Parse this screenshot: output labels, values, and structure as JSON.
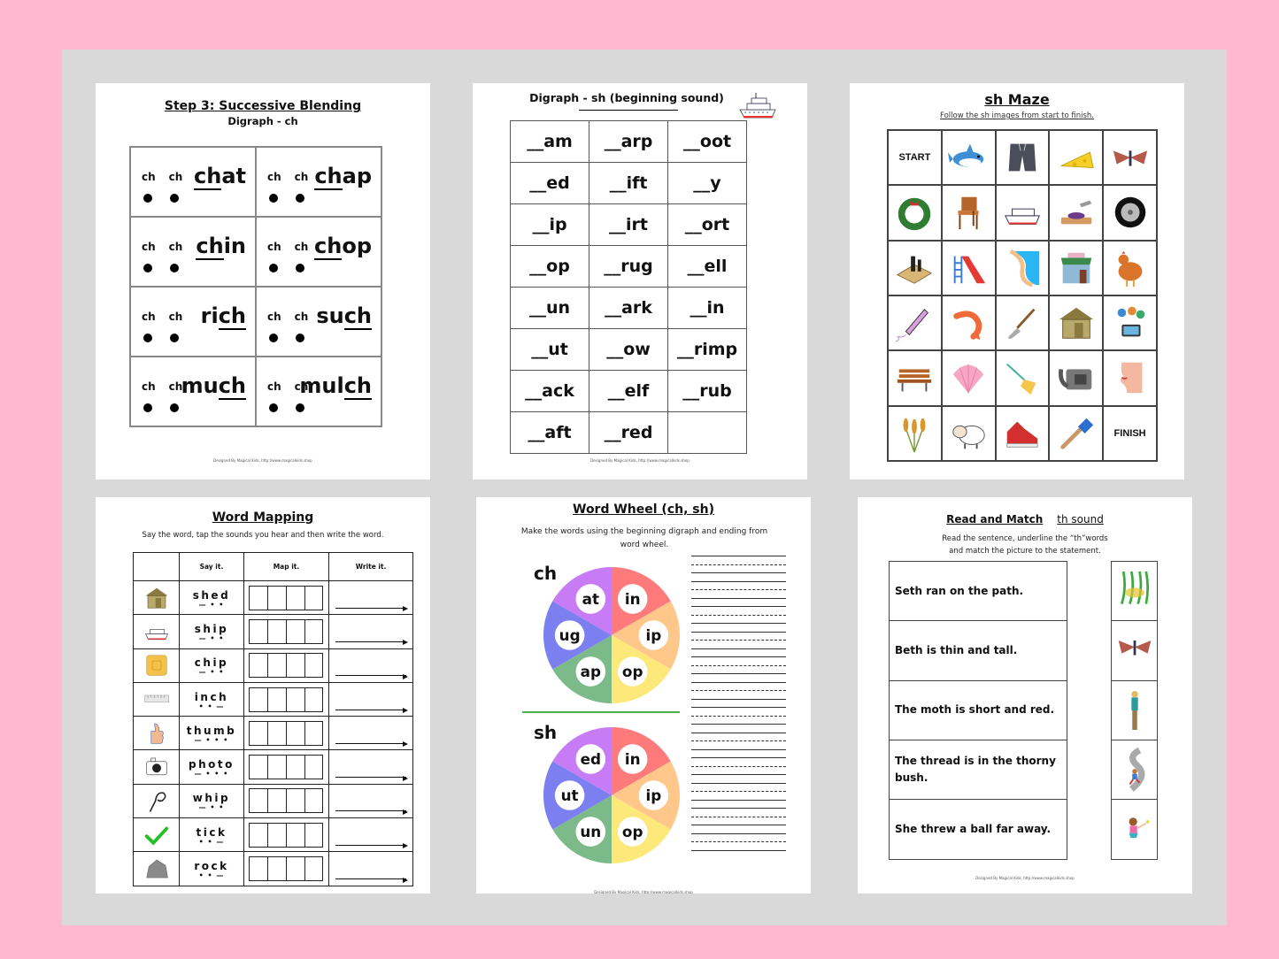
{
  "colors": {
    "background": "#ffb8cf",
    "board": "#d9d9d9",
    "page": "#ffffff",
    "wheel": [
      "#ff7a7a",
      "#ffc88a",
      "#fde87a",
      "#7dba8a",
      "#7c7ff0",
      "#c77bf5"
    ],
    "divider": "#4caf50"
  },
  "footer_credit": "Designed By Magical Kids, http://www.magicalkids.shop",
  "page1": {
    "title": "Step 3: Successive Blending",
    "subtitle": "Digraph - ch",
    "sound_label": "ch",
    "cells": [
      {
        "pre": "",
        "ul": "ch",
        "post": "at",
        "word": "chat"
      },
      {
        "pre": "",
        "ul": "ch",
        "post": "ap",
        "word": "chap"
      },
      {
        "pre": "",
        "ul": "ch",
        "post": "in",
        "word": "chin"
      },
      {
        "pre": "",
        "ul": "ch",
        "post": "op",
        "word": "chop"
      },
      {
        "pre": "ri",
        "ul": "ch",
        "post": "",
        "word": "rich"
      },
      {
        "pre": "su",
        "ul": "ch",
        "post": "",
        "word": "such"
      },
      {
        "pre": "mu",
        "ul": "ch",
        "post": "",
        "word": "much"
      },
      {
        "pre": "mul",
        "ul": "ch",
        "post": "",
        "word": "mulch"
      }
    ]
  },
  "page2": {
    "title": "Digraph - sh (beginning sound)",
    "icon": "cruise-ship-icon",
    "rows": [
      [
        "__am",
        "__arp",
        "__oot"
      ],
      [
        "__ed",
        "__ift",
        "__y"
      ],
      [
        "__ip",
        "__irt",
        "__ort"
      ],
      [
        "__op",
        "__rug",
        "__ell"
      ],
      [
        "__un",
        "__ark",
        "__in"
      ],
      [
        "__ut",
        "__ow",
        "__rimp"
      ],
      [
        "__ack",
        "__elf",
        "__rub"
      ],
      [
        "__aft",
        "__red",
        ""
      ]
    ]
  },
  "page3": {
    "title": "sh Maze",
    "instruction": "Follow the sh images from start to finish.",
    "start_label": "START",
    "finish_label": "FINISH",
    "grid": [
      [
        "START",
        "shark",
        "shorts",
        "cheese",
        "moth"
      ],
      [
        "wreath",
        "chair",
        "ship",
        "chop",
        "wheel"
      ],
      [
        "chess",
        "slide",
        "shore",
        "shop",
        "chicken"
      ],
      [
        "chalk",
        "shrimp",
        "shovel",
        "shed",
        "photo"
      ],
      [
        "bench",
        "shell",
        "brush",
        "phone",
        "chin"
      ],
      [
        "wheat",
        "sheep",
        "shoe",
        "paintbrush",
        "FINISH"
      ]
    ]
  },
  "page4": {
    "title": "Word Mapping",
    "instruction": "Say the word, tap the sounds you hear and then write the word.",
    "headers": [
      "",
      "Say it.",
      "Map it.",
      "Write it."
    ],
    "rows": [
      {
        "picture": "shed",
        "word": "shed",
        "marks": "— • •"
      },
      {
        "picture": "ship",
        "word": "ship",
        "marks": "— • •"
      },
      {
        "picture": "chip",
        "word": "chip",
        "marks": "— • •"
      },
      {
        "picture": "ruler",
        "word": "inch",
        "marks": "• • —"
      },
      {
        "picture": "thumb",
        "word": "thumb",
        "marks": "— • • •"
      },
      {
        "picture": "camera",
        "word": "photo",
        "marks": "— • • •"
      },
      {
        "picture": "whip",
        "word": "whip",
        "marks": "— • •"
      },
      {
        "picture": "tick",
        "word": "tick",
        "marks": "• • —"
      },
      {
        "picture": "rock",
        "word": "rock",
        "marks": "• • —"
      }
    ]
  },
  "page5": {
    "title": "Word Wheel (ch, sh)",
    "instruction": "Make the words using the beginning digraph and ending from word wheel.",
    "wheels": [
      {
        "digraph": "ch",
        "endings": [
          "in",
          "ip",
          "op",
          "ap",
          "ug",
          "at"
        ]
      },
      {
        "digraph": "sh",
        "endings": [
          "in",
          "ip",
          "op",
          "un",
          "ut",
          "ed"
        ]
      }
    ]
  },
  "page6": {
    "title": "Read and Match",
    "title_sound": "th sound",
    "instruction_line1": "Read the sentence, underline the “th”words",
    "instruction_line2": "and match the picture to the statement.",
    "sentences": [
      "Seth ran on the path.",
      "Beth is thin and tall.",
      "The moth is short and red.",
      "The thread is in the thorny bush.",
      "She threw a ball far away."
    ],
    "pictures": [
      "thorny-bush",
      "moth",
      "tall-woman",
      "boy-running-path",
      "girl-throwing-ball"
    ]
  }
}
